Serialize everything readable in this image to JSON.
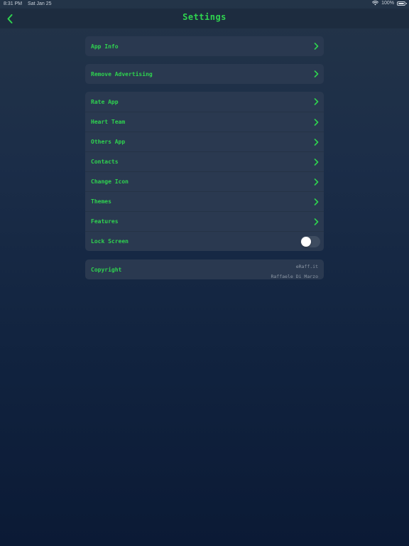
{
  "status_bar": {
    "time": "8:31 PM",
    "date": "Sat Jan 25",
    "battery": "100%",
    "wifi_icon": "wifi-icon",
    "battery_icon": "battery-icon"
  },
  "nav": {
    "title": "Settings",
    "back_icon": "chevron-left-icon"
  },
  "groups": [
    {
      "items": [
        {
          "label": "App Info"
        }
      ]
    },
    {
      "items": [
        {
          "label": "Remove Advertising"
        }
      ]
    },
    {
      "items": [
        {
          "label": "Rate App"
        },
        {
          "label": "Heart Team"
        },
        {
          "label": "Others App"
        },
        {
          "label": "Contacts"
        },
        {
          "label": "Change Icon"
        },
        {
          "label": "Themes"
        },
        {
          "label": "Features"
        },
        {
          "label": "Lock Screen",
          "toggle_on": false
        }
      ]
    },
    {
      "items": [
        {
          "label": "Copyright",
          "site": "eRaff.it",
          "author": "Raffaele Di Marzo"
        }
      ]
    }
  ],
  "colors": {
    "accent": "#2fd34f",
    "row_bg": "#2a3950",
    "nav_bg": "#1d2c3f",
    "secondary_text": "#8d98a6"
  }
}
